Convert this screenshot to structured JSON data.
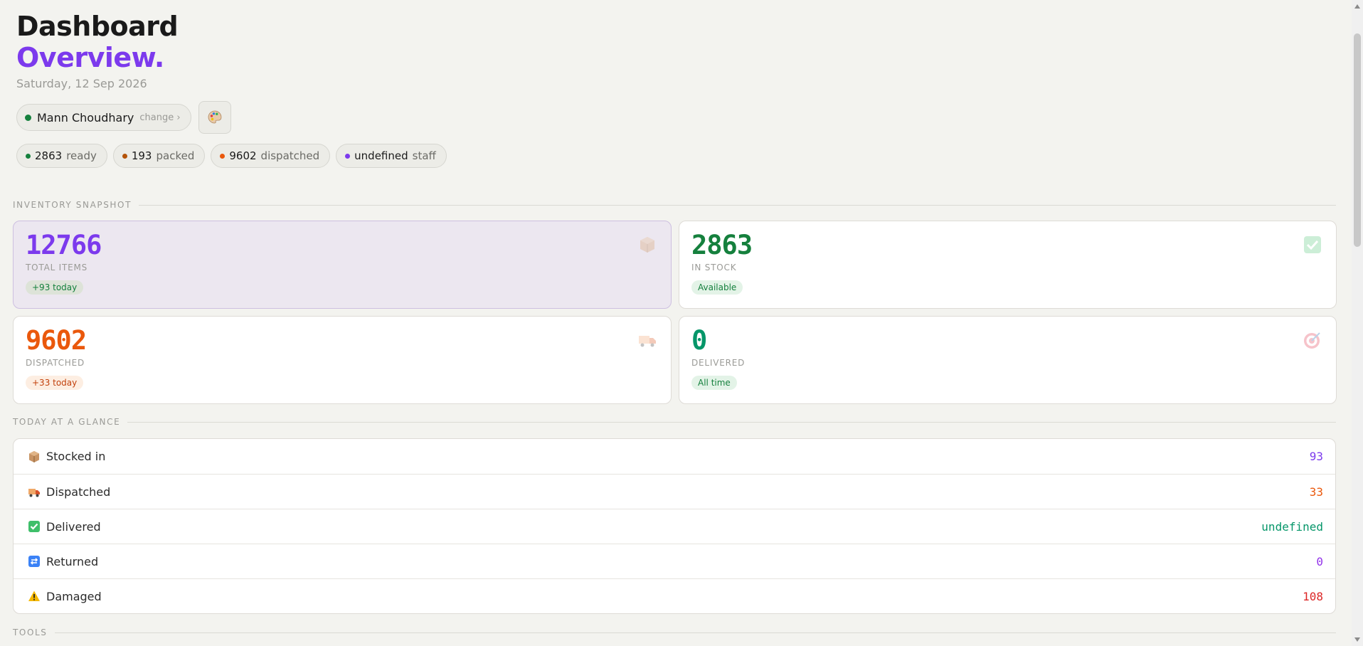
{
  "header": {
    "title": "Dashboard",
    "subtitle": "Overview.",
    "date": "Saturday, 12 Sep 2026"
  },
  "user": {
    "name": "Mann Choudhary",
    "change_label": "change ›",
    "status_color": "#15803d"
  },
  "palette_button": {
    "icon": "palette-icon"
  },
  "stats": [
    {
      "value": "2863",
      "label": "ready",
      "color": "#15803d"
    },
    {
      "value": "193",
      "label": "packed",
      "color": "#b45309"
    },
    {
      "value": "9602",
      "label": "dispatched",
      "color": "#ea580c"
    },
    {
      "value": "undefined",
      "label": "staff",
      "color": "#7c3aed"
    }
  ],
  "sections": {
    "inventory": "INVENTORY SNAPSHOT",
    "today": "TODAY AT A GLANCE",
    "tools": "TOOLS"
  },
  "cards": [
    {
      "value": "12766",
      "label": "TOTAL ITEMS",
      "badge": "+93 today",
      "color": "#7c3aed",
      "badge_bg": "#dde3d8",
      "badge_color": "#15803d",
      "icon": "box-icon"
    },
    {
      "value": "2863",
      "label": "IN STOCK",
      "badge": "Available",
      "color": "#15803d",
      "badge_bg": "#e3f3e7",
      "badge_color": "#15803d",
      "icon": "check-icon"
    },
    {
      "value": "9602",
      "label": "DISPATCHED",
      "badge": "+33 today",
      "color": "#ea580c",
      "badge_bg": "#fdeee2",
      "badge_color": "#c2410c",
      "icon": "truck-icon"
    },
    {
      "value": "0",
      "label": "DELIVERED",
      "badge": "All time",
      "color": "#059669",
      "badge_bg": "#e3f3e7",
      "badge_color": "#15803d",
      "icon": "target-icon"
    }
  ],
  "today": [
    {
      "label": "Stocked in",
      "value": "93",
      "color": "#7c3aed",
      "icon": "box-icon"
    },
    {
      "label": "Dispatched",
      "value": "33",
      "color": "#ea580c",
      "icon": "truck-icon"
    },
    {
      "label": "Delivered",
      "value": "undefined",
      "color": "#059669",
      "icon": "check-icon"
    },
    {
      "label": "Returned",
      "value": "0",
      "color": "#9333ea",
      "icon": "return-icon"
    },
    {
      "label": "Damaged",
      "value": "108",
      "color": "#dc2626",
      "icon": "warning-icon"
    }
  ]
}
